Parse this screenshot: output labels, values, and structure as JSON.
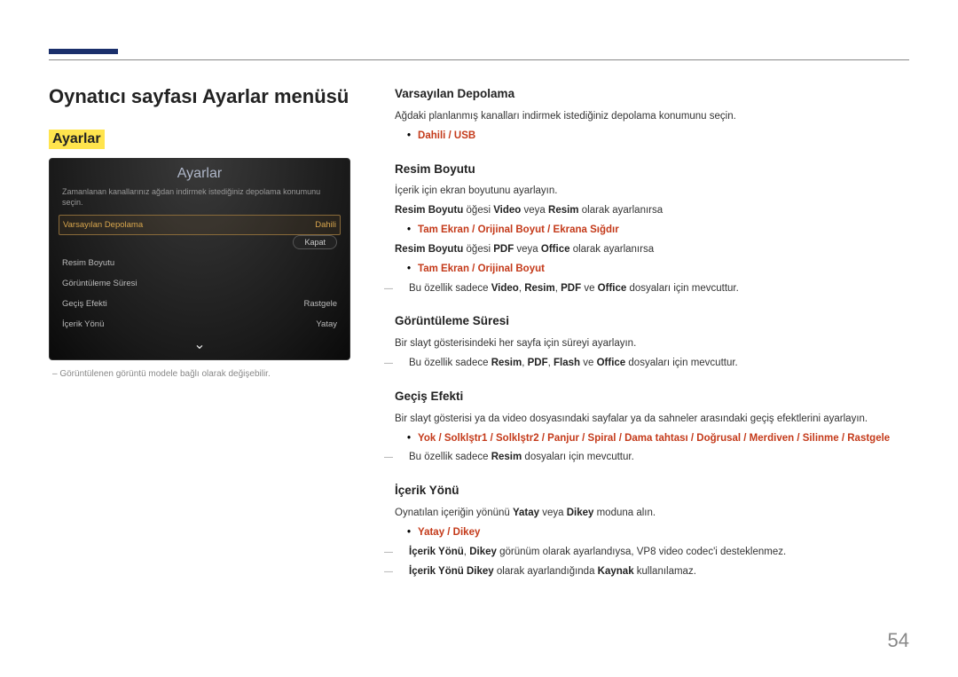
{
  "page_title": "Oynatıcı sayfası Ayarlar menüsü",
  "highlight_label": "Ayarlar",
  "ui_mock": {
    "title": "Ayarlar",
    "description": "Zamanlanan kanallarınız ağdan indirmek istediğiniz depolama konumunu seçin.",
    "rows": [
      {
        "label": "Varsayılan Depolama",
        "value": "Dahili",
        "selected": true
      },
      {
        "label": "Resim Boyutu",
        "value": ""
      },
      {
        "label": "Görüntüleme Süresi",
        "value": ""
      },
      {
        "label": "Geçiş Efekti",
        "value": "Rastgele"
      },
      {
        "label": "İçerik Yönü",
        "value": "Yatay"
      }
    ],
    "close_label": "Kapat"
  },
  "left_note": "Görüntülenen görüntü modele bağlı olarak değişebilir.",
  "sections": {
    "default_storage": {
      "title": "Varsayılan Depolama",
      "desc": "Ağdaki planlanmış kanalları indirmek istediğiniz depolama konumunu seçin.",
      "options": "Dahili / USB"
    },
    "image_size": {
      "title": "Resim Boyutu",
      "desc": "İçerik için ekran boyutunu ayarlayın.",
      "line1a": "Resim Boyutu",
      "line1b": " öğesi ",
      "line1c": "Video",
      "line1d": " veya ",
      "line1e": "Resim",
      "line1f": " olarak ayarlanırsa",
      "opts1": "Tam Ekran / Orijinal Boyut / Ekrana Sığdır",
      "line2a": "Resim Boyutu",
      "line2b": " öğesi ",
      "line2c": "PDF",
      "line2d": " veya ",
      "line2e": "Office",
      "line2f": " olarak ayarlanırsa",
      "opts2": "Tam Ekran / Orijinal Boyut",
      "note_pre": "Bu özellik sadece ",
      "note_b1": "Video",
      "note_c1": ", ",
      "note_b2": "Resim",
      "note_c2": ", ",
      "note_b3": "PDF",
      "note_c3": " ve ",
      "note_b4": "Office",
      "note_post": " dosyaları için mevcuttur."
    },
    "duration": {
      "title": "Görüntüleme Süresi",
      "desc": "Bir slayt gösterisindeki her sayfa için süreyi ayarlayın.",
      "note_pre": "Bu özellik sadece ",
      "note_b1": "Resim",
      "note_c1": ", ",
      "note_b2": "PDF",
      "note_c2": ", ",
      "note_b3": "Flash",
      "note_c3": " ve ",
      "note_b4": "Office",
      "note_post": " dosyaları için mevcuttur."
    },
    "transition": {
      "title": "Geçiş Efekti",
      "desc": "Bir slayt gösterisi ya da video dosyasındaki sayfalar ya da sahneler arasındaki geçiş efektlerini ayarlayın.",
      "options": "Yok / Solklştr1 / Solklştr2 / Panjur / Spiral / Dama tahtası / Doğrusal / Merdiven / Silinme / Rastgele",
      "note_pre": "Bu özellik sadece ",
      "note_b1": "Resim",
      "note_post": " dosyaları için mevcuttur."
    },
    "orientation": {
      "title": "İçerik Yönü",
      "desc_pre": "Oynatılan içeriğin yönünü ",
      "desc_b1": "Yatay",
      "desc_mid": " veya ",
      "desc_b2": "Dikey",
      "desc_post": " moduna alın.",
      "options": "Yatay / Dikey",
      "note1_b1": "İçerik Yönü",
      "note1_c1": ", ",
      "note1_b2": "Dikey",
      "note1_post": " görünüm olarak ayarlandıysa, VP8 video codec'i desteklenmez.",
      "note2_b1": "İçerik Yönü Dikey",
      "note2_mid": " olarak ayarlandığında ",
      "note2_b2": "Kaynak",
      "note2_post": " kullanılamaz."
    }
  },
  "page_number": "54"
}
